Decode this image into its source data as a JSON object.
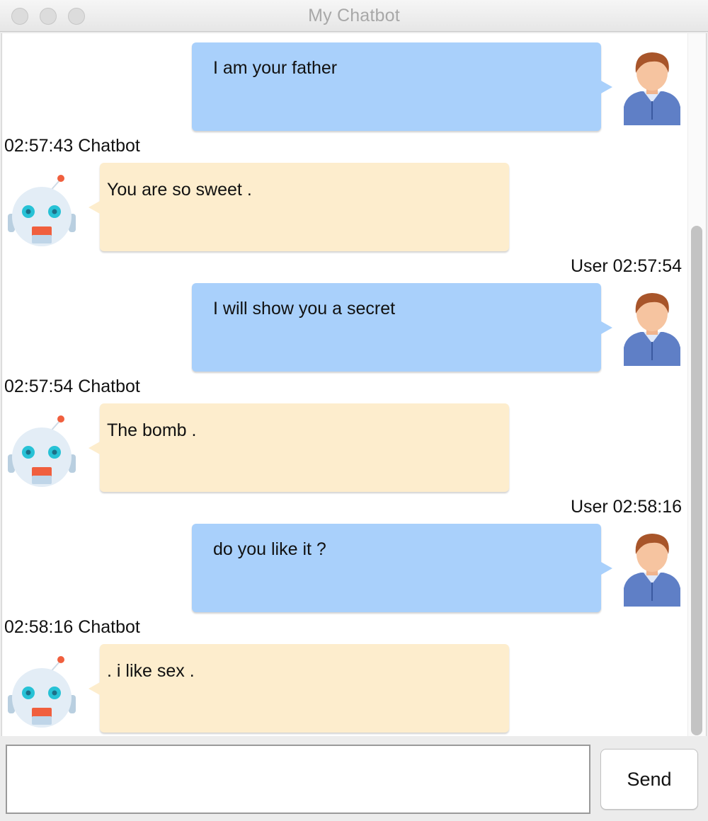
{
  "window": {
    "title": "My Chatbot"
  },
  "messages": [
    {
      "sender": "user",
      "meta": "",
      "text": "I am your father"
    },
    {
      "sender": "bot",
      "meta": "02:57:43 Chatbot",
      "text": "You are so sweet ."
    },
    {
      "sender": "user",
      "meta": "User 02:57:54",
      "text": "I will show you a secret"
    },
    {
      "sender": "bot",
      "meta": "02:57:54 Chatbot",
      "text": "The bomb ."
    },
    {
      "sender": "user",
      "meta": "User 02:58:16",
      "text": "do you like it ?"
    },
    {
      "sender": "bot",
      "meta": "02:58:16 Chatbot",
      "text": ". i like sex ."
    }
  ],
  "composer": {
    "input_value": "",
    "send_label": "Send"
  },
  "colors": {
    "user_bubble": "#a9d0fb",
    "bot_bubble": "#fdedcd"
  },
  "icons": {
    "user_avatar": "user-avatar-icon",
    "bot_avatar": "robot-avatar-icon"
  }
}
